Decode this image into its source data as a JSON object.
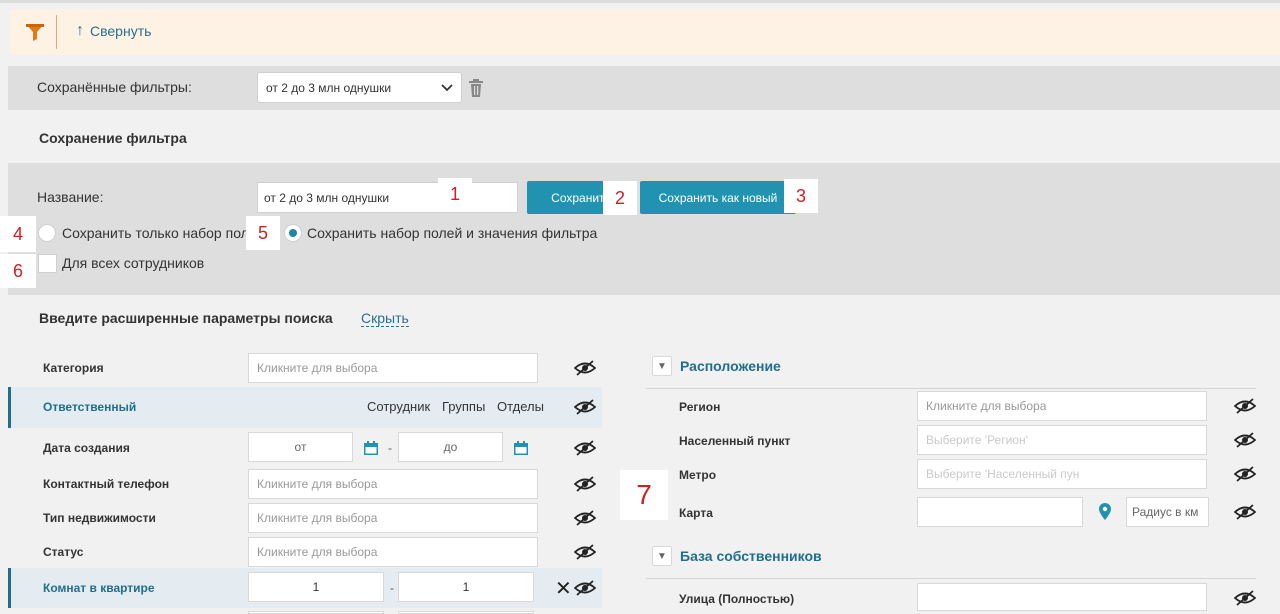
{
  "toolbar": {
    "collapse_label": "Свернуть"
  },
  "saved_filters": {
    "label": "Сохранённые фильтры:",
    "selected": "от 2 до 3 млн однушки"
  },
  "save_filter": {
    "title": "Сохранение фильтра",
    "name_label": "Название:",
    "name_value": "от 2 до 3 млн однушки",
    "save_button": "Сохранить",
    "save_new_button": "Сохранить как новый",
    "option_fields_only": "Сохранить только набор полей",
    "option_fields_values": "Сохранить набор полей и значения фильтра",
    "all_employees": "Для всех сотрудников"
  },
  "badges": [
    "1",
    "2",
    "3",
    "4",
    "5",
    "6",
    "7"
  ],
  "advanced": {
    "title": "Введите расширенные параметры поиска",
    "hide_link": "Скрыть",
    "placeholder": "Кликните для выбора",
    "rows": {
      "category": "Категория",
      "responsible": "Ответственный",
      "responsible_tabs": [
        "Сотрудник",
        "Группы",
        "Отделы"
      ],
      "created": "Дата создания",
      "from": "от",
      "to": "до",
      "phone": "Контактный телефон",
      "property_type": "Тип недвижимости",
      "status": "Статус",
      "rooms": "Комнат в квартире",
      "rooms_from": "1",
      "rooms_to": "1"
    }
  },
  "location": {
    "title": "Расположение",
    "region": "Регион",
    "region_placeholder": "Кликните для выбора",
    "locality": "Населенный пункт",
    "locality_placeholder": "Выберите 'Регион'",
    "metro": "Метро",
    "metro_placeholder": "Выберите 'Населенный пун",
    "map": "Карта",
    "radius_placeholder": "Радиус в км"
  },
  "owners_db": {
    "title": "База собственников",
    "street": "Улица (Полностью)"
  },
  "colors": {
    "accent": "#2193b0",
    "link": "#1f6f8b",
    "toolbar_bg": "#fdf2e4",
    "badge_text": "#cc2222"
  }
}
